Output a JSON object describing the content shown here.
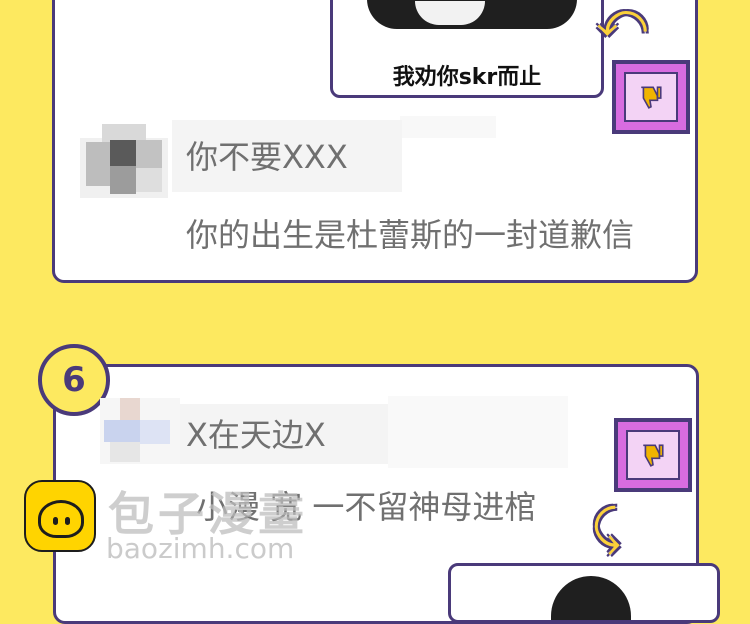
{
  "memes": {
    "top_caption": "我劝你skr而止"
  },
  "comments": [
    {
      "username": "你不要XXX",
      "text": "你的出生是杜蕾斯的一封道歉信"
    },
    {
      "username": "X在天边X",
      "text": "小漫 宽 一不留神母进棺"
    }
  ],
  "rank_badge": "6",
  "icons": {
    "dislike": "thumbs-down-icon",
    "arrow": "curved-arrow-icon"
  },
  "watermark": {
    "title": "包子漫畫",
    "domain": "baozimh.com"
  },
  "colors": {
    "background": "#fde960",
    "border": "#4a3a7a",
    "thumb_frame": "#d86ce0",
    "thumb_icon": "#f0b400",
    "text": "#707070"
  }
}
